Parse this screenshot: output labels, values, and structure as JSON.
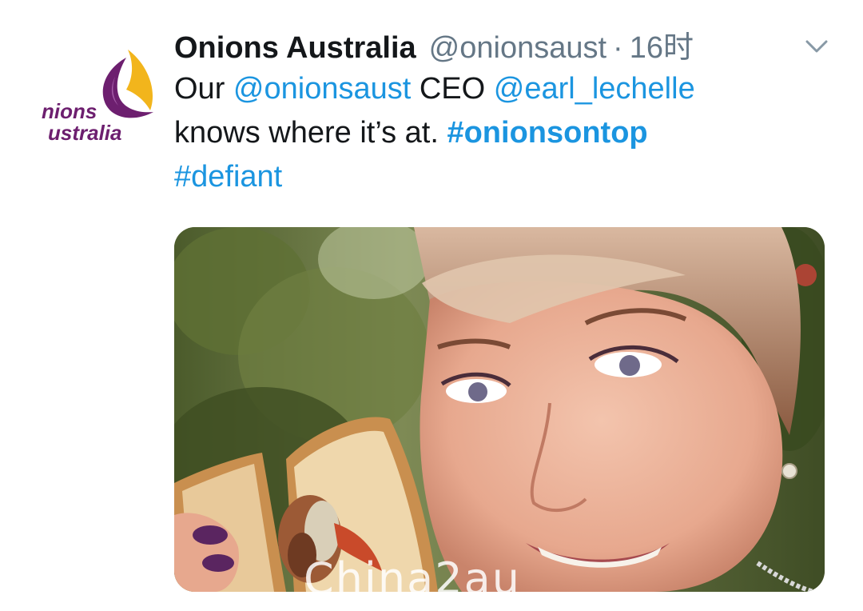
{
  "account": {
    "display_name": "Onions Australia",
    "handle": "@onionsaust",
    "separator": "·",
    "timestamp": "16时",
    "logo_text_line1": "nions",
    "logo_text_line2": "ustralia"
  },
  "tweet": {
    "t1": "Our ",
    "m1": "@onionsaust",
    "t2": " CEO ",
    "m2": "@earl_lechelle",
    "t3": "knows where it’s at. ",
    "h1": "#onionsontop",
    "h2": "#defiant"
  },
  "media": {
    "watermark": "Chinа2au"
  },
  "icons": {
    "menu": "chevron-down-icon"
  },
  "colors": {
    "link": "#1b95e0",
    "text": "#14171a",
    "secondary": "#657786",
    "brand_purple": "#6d1f6f",
    "brand_gold": "#f2b51c"
  }
}
